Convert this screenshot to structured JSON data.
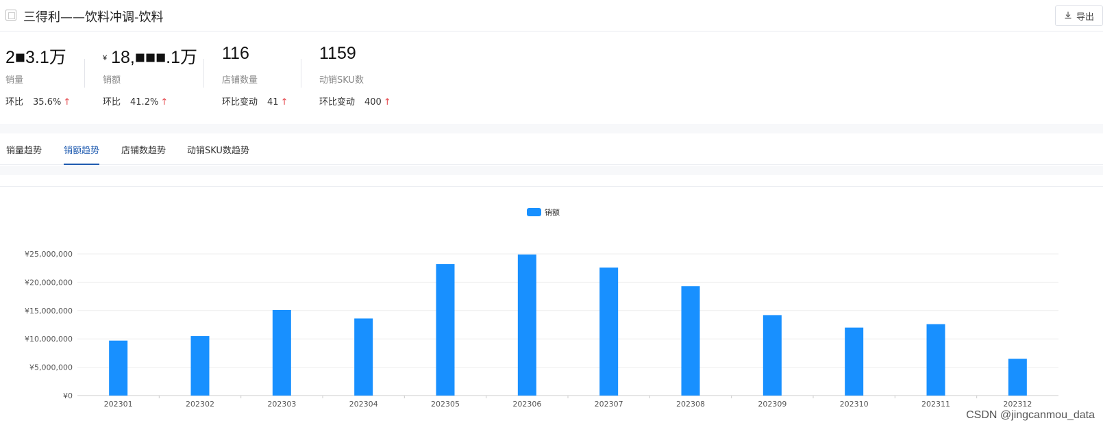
{
  "header": {
    "title": "三得利——饮料冲调-饮料",
    "export_label": "导出"
  },
  "stats": [
    {
      "value": "2■3.1万",
      "label": "销量",
      "delta_label": "环比",
      "delta_value": "35.6%",
      "arrow": "↑",
      "currency": ""
    },
    {
      "value": "18,■■■.1万",
      "label": "销额",
      "delta_label": "环比",
      "delta_value": "41.2%",
      "arrow": "↑",
      "currency": "¥"
    },
    {
      "value": "116",
      "label": "店铺数量",
      "delta_label": "环比变动",
      "delta_value": "41",
      "arrow": "↑",
      "currency": ""
    },
    {
      "value": "1159",
      "label": "动销SKU数",
      "delta_label": "环比变动",
      "delta_value": "400",
      "arrow": "↑",
      "currency": ""
    }
  ],
  "tabs": [
    {
      "label": "销量趋势",
      "active": false
    },
    {
      "label": "销额趋势",
      "active": true
    },
    {
      "label": "店铺数趋势",
      "active": false
    },
    {
      "label": "动销SKU数趋势",
      "active": false
    }
  ],
  "chart_data": {
    "type": "bar",
    "legend": "销额",
    "series_name": "销额",
    "bar_color": "#1890ff",
    "categories": [
      "202301",
      "202302",
      "202303",
      "202304",
      "202305",
      "202306",
      "202307",
      "202308",
      "202309",
      "202310",
      "202311",
      "202312"
    ],
    "values": [
      9700000,
      10500000,
      15100000,
      13600000,
      23200000,
      24900000,
      22600000,
      19300000,
      14200000,
      12000000,
      12600000,
      6500000
    ],
    "ylim": [
      0,
      25000000
    ],
    "y_ticks": [
      0,
      5000000,
      10000000,
      15000000,
      20000000,
      25000000
    ],
    "y_tick_labels": [
      "¥0",
      "¥5,000,000",
      "¥10,000,000",
      "¥15,000,000",
      "¥20,000,000",
      "¥25,000,000"
    ],
    "grid": true,
    "legend_position": "top-center"
  },
  "watermark": "CSDN @jingcanmou_data",
  "colors": {
    "accent": "#1f5bb0",
    "bar": "#1890ff",
    "arrow_up": "#e5484d"
  }
}
